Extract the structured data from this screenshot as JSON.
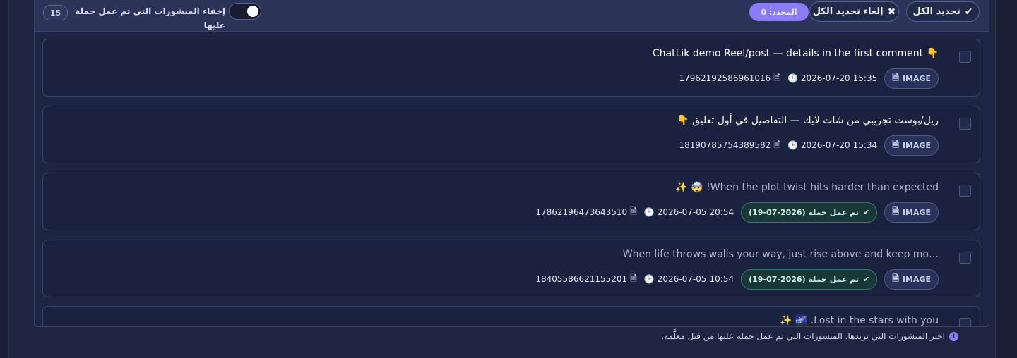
{
  "toolbar": {
    "select_all_label": "تحديد الكل",
    "select_all_icon": "double-check-icon",
    "deselect_all_label": "إلغاء تحديد الكل",
    "deselect_all_icon": "x-icon",
    "selected_label": "المحدد: 0",
    "hide_used_label": "إخفاء المنشورات التي تم عمل حملة عليها",
    "hide_used_toggle_on": false,
    "hidden_count": "15"
  },
  "posts": [
    {
      "title": "ChatLik demo Reel/post — details in the first comment 👇",
      "type": "IMAGE",
      "date": "2026-07-20",
      "time": "15:35",
      "post_id": "17962192586961016",
      "campaign": null
    },
    {
      "title": "ريل/بوست تجريبي من شات لايك — التفاصيل في أول تعليق 👇",
      "type": "IMAGE",
      "date": "2026-07-20",
      "time": "15:34",
      "post_id": "18190785754389582",
      "campaign": null
    },
    {
      "title": "When the plot twist hits harder than expected! 🤯 ✨",
      "type": "IMAGE",
      "date": "2026-07-05",
      "time": "20:54",
      "post_id": "17862196473643510",
      "campaign": "تم عمل حملة (2026-07-19)"
    },
    {
      "title": "When life throws walls your way, just rise above and keep mo…",
      "type": "IMAGE",
      "date": "2026-07-05",
      "time": "10:54",
      "post_id": "18405586621155201",
      "campaign": "تم عمل حملة (2026-07-19)"
    },
    {
      "title": "Lost in the stars with you. 🌌 ✨",
      "type": "",
      "date": "",
      "time": "",
      "post_id": "",
      "campaign": null
    }
  ],
  "footer": {
    "note": "اختر المنشورات التي تريدها. المنشورات التي تم عمل حملة عليها من قبل معلَّمة.",
    "icon": "info-icon"
  },
  "colors": {
    "accent": "#8b7cf6",
    "campaign_badge": "#173837",
    "background": "#1a1f35"
  }
}
